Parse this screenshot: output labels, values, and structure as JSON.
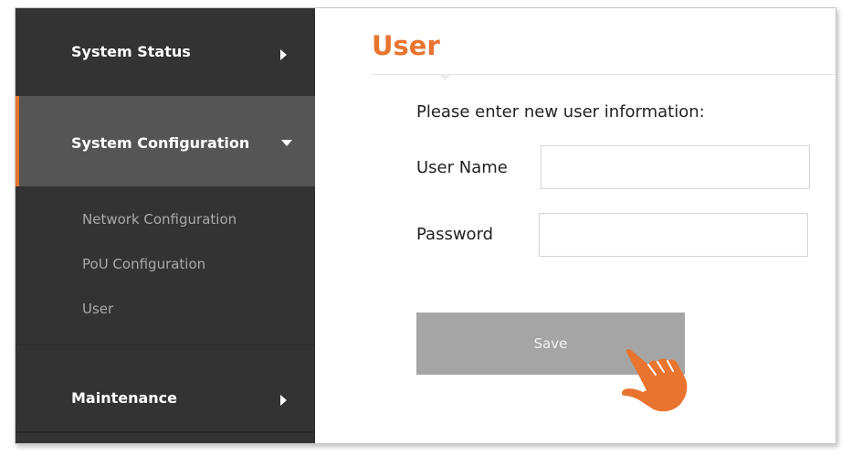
{
  "sidebar": {
    "items": [
      {
        "label": "System Status"
      },
      {
        "label": "System Configuration",
        "subitems": [
          {
            "label": "Network Configuration"
          },
          {
            "label": "PoU Configuration"
          },
          {
            "label": "User"
          }
        ]
      },
      {
        "label": "Maintenance"
      }
    ]
  },
  "main": {
    "title": "User",
    "instruction": "Please enter new user information:",
    "fields": [
      {
        "label": "User Name",
        "value": ""
      },
      {
        "label": "Password",
        "value": ""
      }
    ],
    "save_label": "Save"
  },
  "colors": {
    "accent": "#e8742f",
    "sidebar_bg": "#333333",
    "sidebar_active_bg": "#555555",
    "button_bg": "#a5a5a5"
  },
  "icons": {
    "pointer": "pointing-hand-icon",
    "collapsed": "triangle-right-icon",
    "expanded": "triangle-down-icon"
  }
}
